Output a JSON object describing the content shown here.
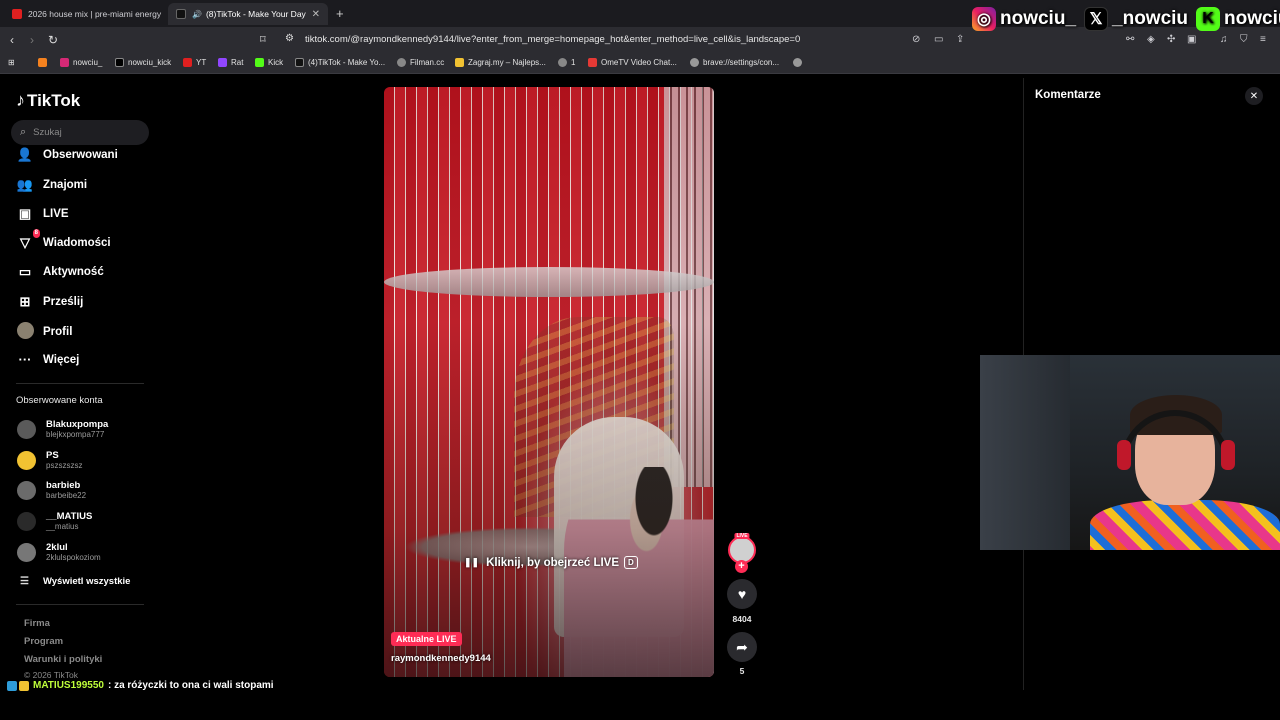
{
  "browser": {
    "tabs": [
      {
        "label": "2026 house mix | pre-miami energy",
        "favicon": "youtube-icon"
      },
      {
        "label": "(8)TikTok - Make Your Day",
        "favicon": "tiktok-icon",
        "active": true
      }
    ],
    "url": "tiktok.com/@raymondkennedy9144/live?enter_from_merge=homepage_hot&enter_method=live_cell&is_landscape=0",
    "bookmarks": [
      {
        "label": "",
        "icon": "brave-icon"
      },
      {
        "label": "nowciu_",
        "icon": "instagram-icon"
      },
      {
        "label": "nowciu_kick",
        "icon": "x-icon"
      },
      {
        "label": "YT",
        "icon": "youtube-icon"
      },
      {
        "label": "Rat",
        "icon": "twitch-icon"
      },
      {
        "label": "Kick",
        "icon": "kick-icon"
      },
      {
        "label": "(4)TikTok - Make Yo...",
        "icon": "tiktok-icon"
      },
      {
        "label": "Filman.cc",
        "icon": "globe-icon"
      },
      {
        "label": "Zagraj.my – Najleps...",
        "icon": "game-icon"
      },
      {
        "label": "1",
        "icon": "globe-icon"
      },
      {
        "label": "OmeTV Video Chat...",
        "icon": "ometv-icon"
      },
      {
        "label": "brave://settings/con...",
        "icon": "settings-icon"
      },
      {
        "label": "",
        "icon": "globe-icon"
      }
    ]
  },
  "overlay": {
    "socials": [
      {
        "icon": "instagram-icon",
        "name": "nowciu_"
      },
      {
        "icon": "x-icon",
        "name": "_nowciu"
      },
      {
        "icon": "kick-icon",
        "name": "nowciu"
      }
    ]
  },
  "sidebar": {
    "logo": "TikTok",
    "search_placeholder": "Szukaj",
    "nav": [
      {
        "label": "Obserwowani",
        "icon": "following-icon"
      },
      {
        "label": "Znajomi",
        "icon": "friends-icon"
      },
      {
        "label": "LIVE",
        "icon": "live-icon"
      },
      {
        "label": "Wiadomości",
        "icon": "messages-icon",
        "badge": "8"
      },
      {
        "label": "Aktywność",
        "icon": "activity-icon"
      },
      {
        "label": "Prześlij",
        "icon": "upload-icon"
      },
      {
        "label": "Profil",
        "icon": "profile-icon"
      },
      {
        "label": "Więcej",
        "icon": "more-icon"
      }
    ],
    "followed_title": "Obserwowane konta",
    "accounts": [
      {
        "name": "Blakuxpompa",
        "username": "blejkxpompa777",
        "color": "#5a5a5a"
      },
      {
        "name": "PS",
        "username": "pszszszsz",
        "color": "#f1c232"
      },
      {
        "name": "barbieb",
        "username": "barbeibe22",
        "color": "#6b6b6b"
      },
      {
        "name": "__MATIUS",
        "username": "__matius",
        "color": "#2a2a2a"
      },
      {
        "name": "2klul",
        "username": "2klulspokoziom",
        "color": "#777777"
      }
    ],
    "show_all": "Wyświetl wszystkie",
    "footer": [
      "Firma",
      "Program",
      "Warunki i polityki"
    ],
    "copyright": "© 2026 TikTok"
  },
  "video": {
    "click_hint": "Kliknij, by obejrzeć LIVE",
    "key": "D",
    "live_label": "Aktualne LIVE",
    "streamer": "raymondkennedy9144"
  },
  "actions": {
    "live_badge": "LIVE",
    "likes": "8404",
    "shares": "5"
  },
  "comments": {
    "title": "Komentarze"
  },
  "chat": {
    "user": "MATIUS199550",
    "message": ": za różyczki to ona ci wali stopami"
  }
}
